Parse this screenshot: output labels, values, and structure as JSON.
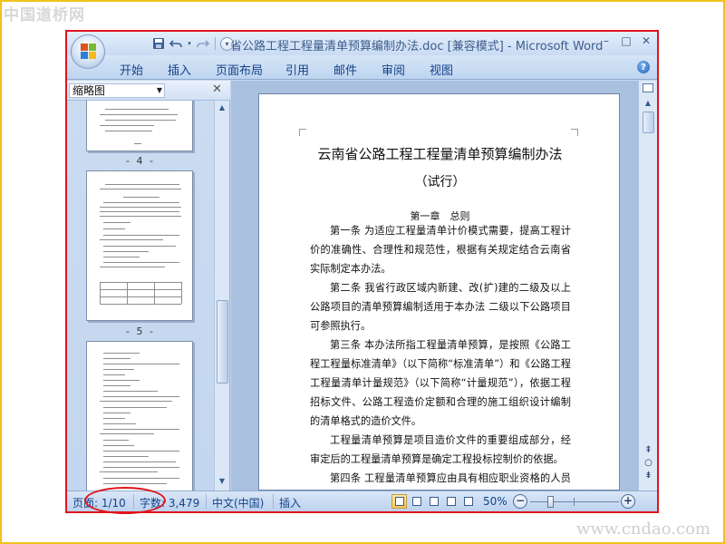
{
  "watermarks": {
    "top_left": "中国道桥网",
    "bottom_right": "www.cndao.com"
  },
  "window": {
    "title": "省公路工程工程量清单预算编制办法.doc [兼容模式] - Microsoft Word",
    "controls": {
      "minimize": "–",
      "maximize": "□",
      "close": "✕"
    }
  },
  "quick_access": {
    "save_icon": "save-icon",
    "undo_icon": "undo-icon",
    "redo_icon": "redo-icon",
    "customize_icon": "customize-icon"
  },
  "ribbon": {
    "tabs": [
      "开始",
      "插入",
      "页面布局",
      "引用",
      "邮件",
      "审阅",
      "视图"
    ],
    "help_label": "?"
  },
  "thumbnail_pane": {
    "selector_value": "缩略图",
    "close_label": "✕",
    "page_labels": [
      "- 4 -",
      "- 5 -"
    ]
  },
  "document": {
    "title": "云南省公路工程工程量清单预算编制办法",
    "subtitle": "（试行）",
    "chapter": "第一章　总则",
    "paragraphs": [
      "第一条 为适应工程量清单计价模式需要，提高工程计价的准确性、合理性和规范性，根据有关规定结合云南省实际制定本办法。",
      "第二条 我省行政区域内新建、改(扩)建的二级及以上公路项目的清单预算编制适用于本办法 二级以下公路项目可参照执行。",
      "第三条 本办法所指工程量清单预算，是按照《公路工程工程量标准清单》（以下简称“标准清单”）和《公路工程工程量清单计量规范》（以下简称“计量规范”），依据工程招标文件、公路工程造价定额和合理的施工组织设计编制的清单格式的造价文件。",
      "工程量清单预算是项目造价文件的重要组成部分，经审定后的工程量清单预算是确定工程投标控制价的依据。",
      "第四条 工程量清单预算应由具有相应职业资格的人员编"
    ]
  },
  "status_bar": {
    "page": "页面: 1/10",
    "words": "字数: 3,479",
    "language": "中文(中国)",
    "mode": "插入",
    "zoom": "50%",
    "zoom_out": "−",
    "zoom_in": "+"
  },
  "colors": {
    "annotation_red": "#e0141d",
    "frame_yellow": "#f0c31d",
    "ribbon_text": "#15428b"
  }
}
